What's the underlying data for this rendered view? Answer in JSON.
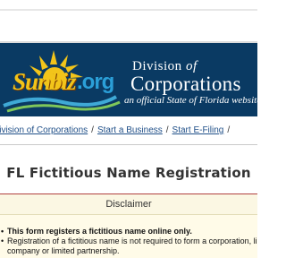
{
  "header": {
    "logo_sunbiz": "Sunbiz",
    "logo_org": ".org",
    "division_line1": "Division",
    "division_of": "of",
    "division_line2": "Corporations",
    "tagline": "an official State of Florida website"
  },
  "breadcrumb": {
    "items": [
      "Division of Corporations",
      "Start a Business",
      "Start E-Filing"
    ],
    "separator": "/"
  },
  "page": {
    "title": "FL Fictitious Name Registration"
  },
  "disclaimer": {
    "heading": "Disclaimer",
    "bullets": [
      "This form registers a fictitious name online only.",
      "Registration of a fictitious name is not required to form a corporation, limited liability",
      "company or limited partnership."
    ]
  },
  "colors": {
    "banner": "#0a3a63",
    "sun": "#f2c41a",
    "org_blue": "#2b9fd8",
    "link": "#1f4f88",
    "disclaimer_border": "#b0413e",
    "disclaimer_bg": "#fffbe8"
  }
}
